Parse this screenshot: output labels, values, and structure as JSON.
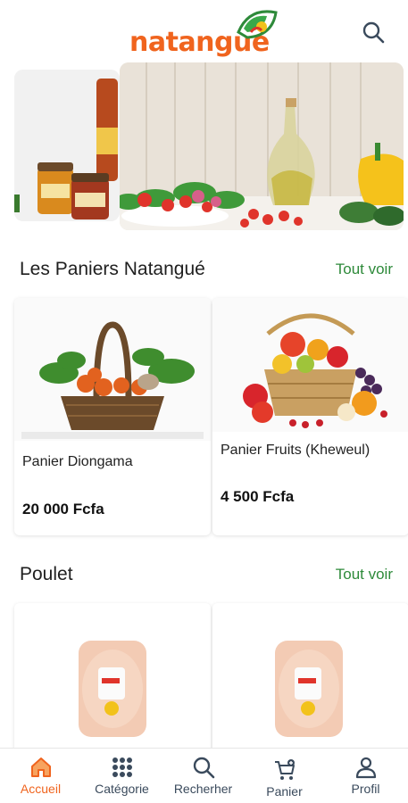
{
  "app": {
    "brand": "natangué"
  },
  "colors": {
    "brand": "#f0641e",
    "accent_green": "#2e8a3a",
    "nav_text": "#3a4a5c"
  },
  "header": {
    "search_icon": "search-icon"
  },
  "sections": [
    {
      "title": "Les Paniers Natangué",
      "see_all": "Tout voir",
      "products": [
        {
          "name": "Panier Diongama",
          "price": "20 000 Fcfa"
        },
        {
          "name": "Panier Fruits (Kheweul)",
          "price": "4 500 Fcfa"
        }
      ]
    },
    {
      "title": "Poulet",
      "see_all": "Tout voir"
    }
  ],
  "nav": [
    {
      "label": "Accueil",
      "icon": "home-icon",
      "active": true
    },
    {
      "label": "Catégorie",
      "icon": "grid-icon"
    },
    {
      "label": "Recherher",
      "icon": "search-icon"
    },
    {
      "label": "Panier",
      "icon": "cart-icon"
    },
    {
      "label": "Profil",
      "icon": "user-icon"
    }
  ]
}
